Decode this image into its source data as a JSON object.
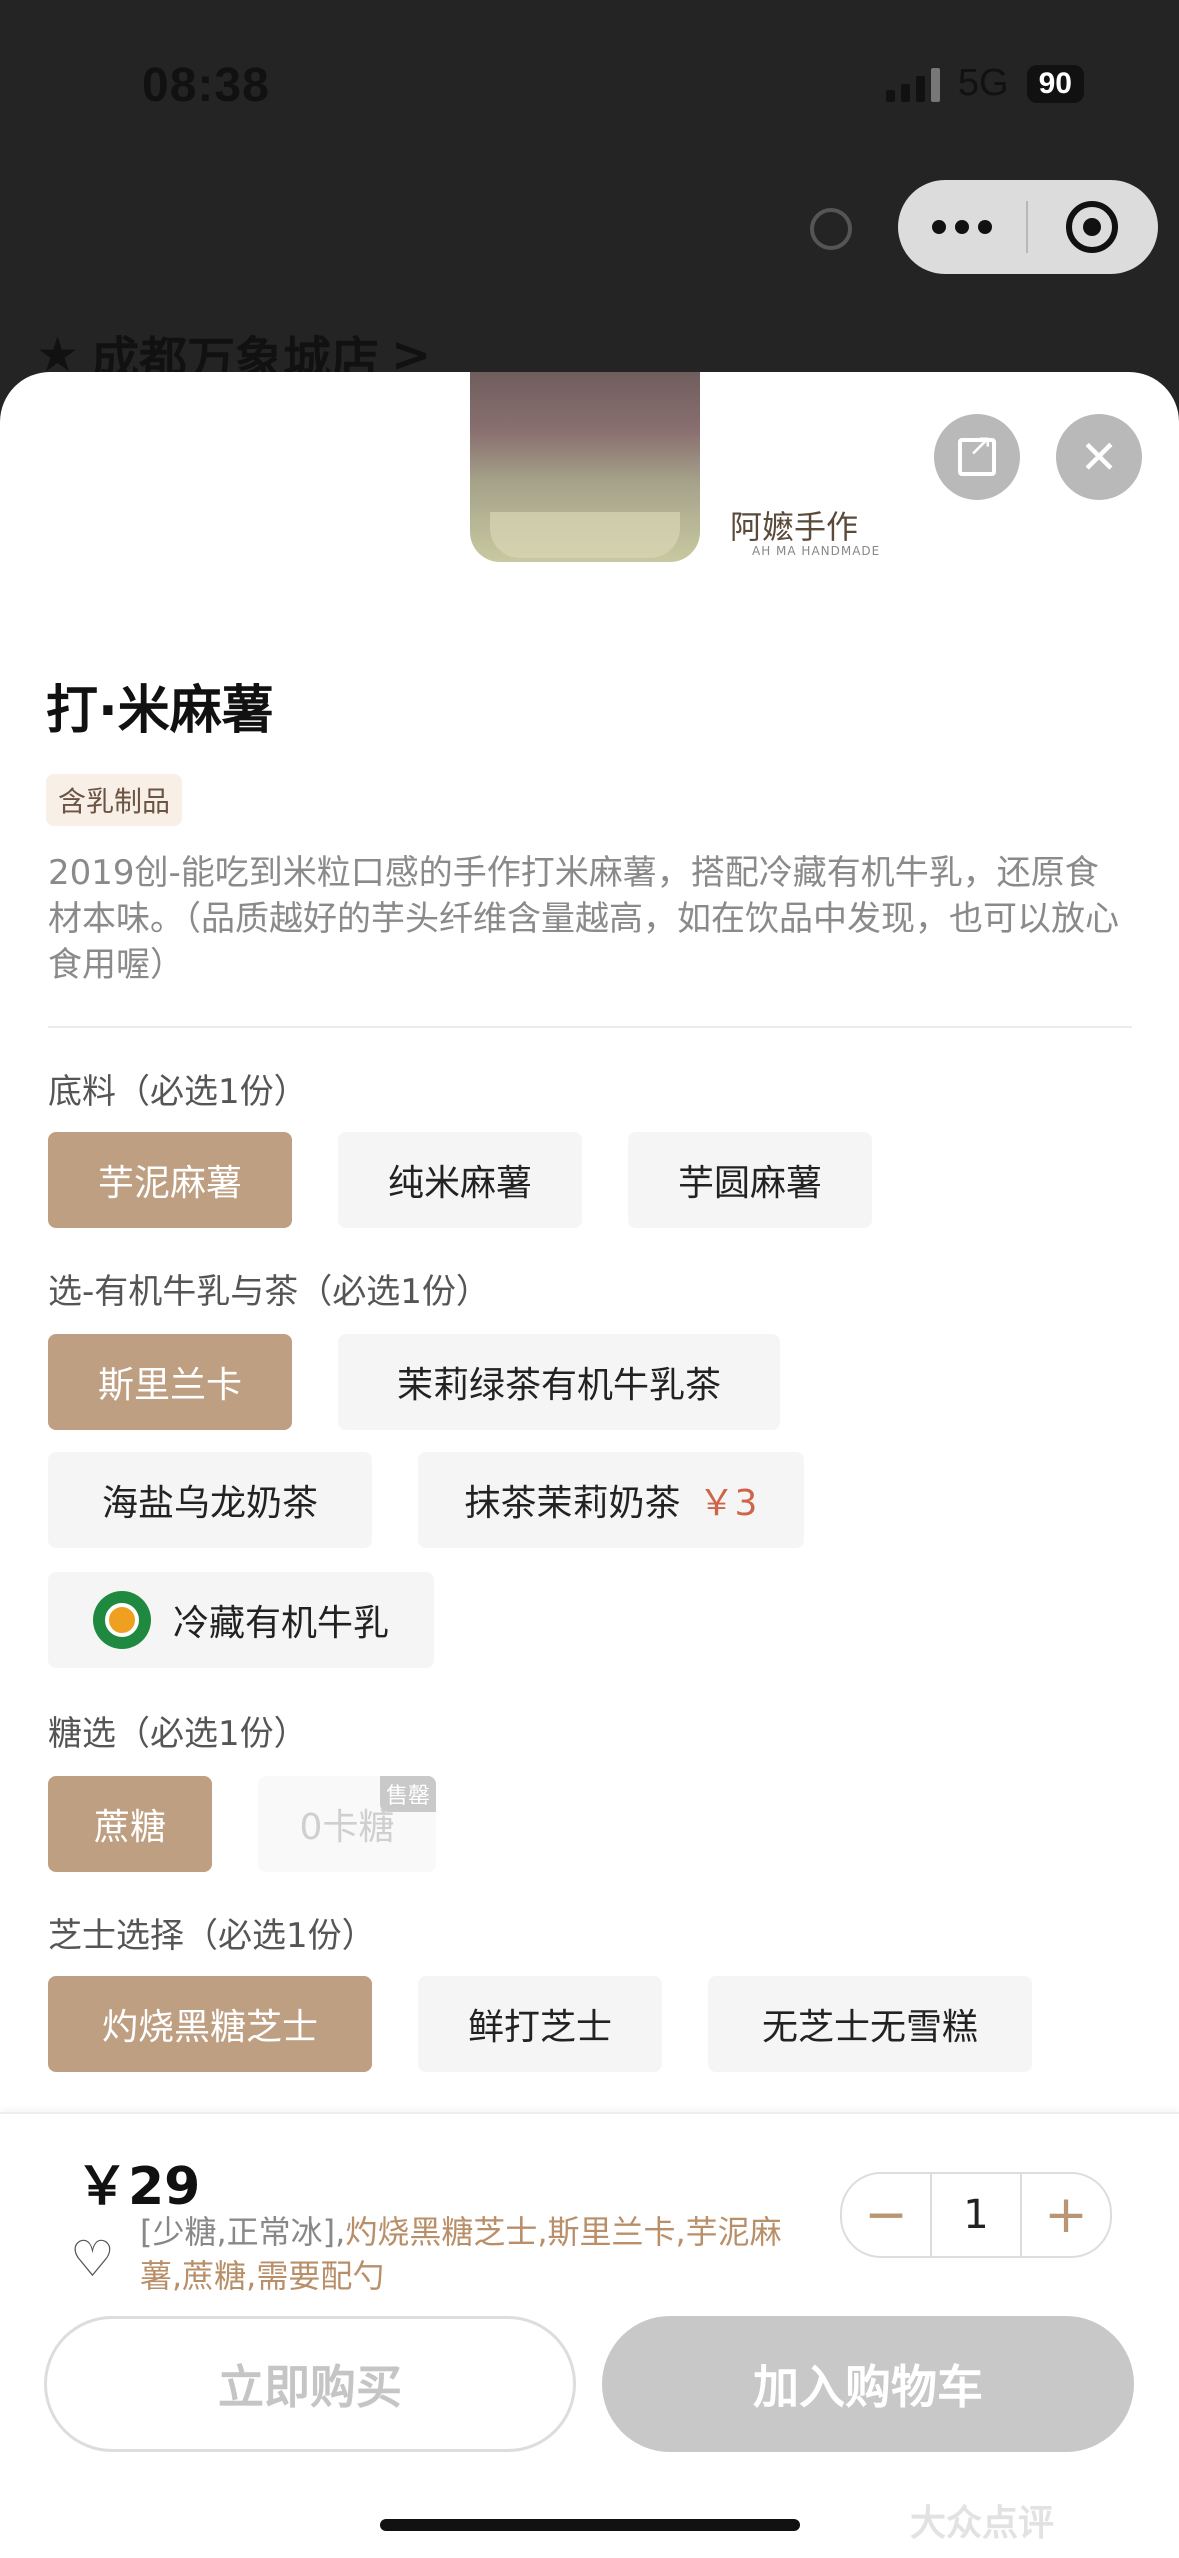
{
  "status": {
    "time": "08:38",
    "network": "5G",
    "battery": "90"
  },
  "background_page": {
    "store_name": "成都万象城店",
    "chevron": ">"
  },
  "product": {
    "brand": "阿嬷手作",
    "brand_sub": "AH MA HANDMADE",
    "title": "打·米麻薯",
    "tag": "含乳制品",
    "description": "2019创-能吃到米粒口感的手作打米麻薯，搭配冷藏有机牛乳，还原食材本味。（品质越好的芋头纤维含量越高，如在饮品中发现，也可以放心食用喔）"
  },
  "sections": {
    "base": {
      "label": "底料（必选1份）",
      "options": [
        "芋泥麻薯",
        "纯米麻薯",
        "芋圆麻薯"
      ]
    },
    "milk_tea": {
      "label": "选-有机牛乳与茶（必选1份）",
      "options": [
        "斯里兰卡",
        "茉莉绿茶有机牛乳茶",
        "海盐乌龙奶茶",
        "抹茶茉莉奶茶",
        "冷藏有机牛乳"
      ],
      "price_extra": "￥3"
    },
    "sugar": {
      "label": "糖选（必选1份）",
      "options": [
        "蔗糖",
        "0卡糖"
      ],
      "sold_out": "售罄"
    },
    "cheese": {
      "label": "芝士选择（必选1份）",
      "options": [
        "灼烧黑糖芝士",
        "鲜打芝士",
        "无芝士无雪糕"
      ]
    }
  },
  "bottom": {
    "price": "￥29",
    "summary_plain": "[少糖,正常冰],",
    "summary_highlight": "灼烧黑糖芝士,斯里兰卡,芋泥麻薯,蔗糖,需要配勺",
    "quantity": "1",
    "minus": "−",
    "plus": "+",
    "buy_now": "立即购买",
    "add_to_cart": "加入购物车"
  },
  "watermark": "大众点评",
  "colors": {
    "selected": "#bf9f82",
    "accent_price": "#d0644a",
    "highlight": "#b98f6a"
  }
}
